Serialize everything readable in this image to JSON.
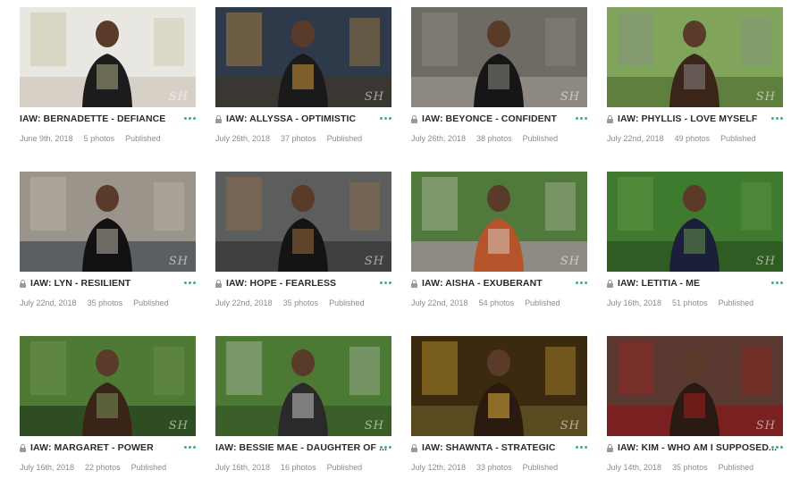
{
  "galleries": [
    {
      "title": "IAW: BERNADETTE - DEFIANCE",
      "date": "June 9th, 2018",
      "photos": "5 photos",
      "status": "Published",
      "locked": false,
      "thumb": {
        "bg": "#e9e7e2",
        "figure": "#1c1c1c",
        "accent": "#b9b98a",
        "ground": "#d6d0c6"
      }
    },
    {
      "title": "IAW: ALLYSSA - OPTIMISTIC",
      "date": "July 26th, 2018",
      "photos": "37 photos",
      "status": "Published",
      "locked": true,
      "thumb": {
        "bg": "#2e3a4a",
        "figure": "#1a1a1a",
        "accent": "#e2a13c",
        "ground": "#3a3632"
      }
    },
    {
      "title": "IAW: BEYONCE - CONFIDENT",
      "date": "July 26th, 2018",
      "photos": "38 photos",
      "status": "Published",
      "locked": true,
      "thumb": {
        "bg": "#6e6a64",
        "figure": "#161616",
        "accent": "#9a968f",
        "ground": "#8d8881"
      }
    },
    {
      "title": "IAW: PHYLLIS - LOVE MYSELF",
      "date": "July 22nd, 2018",
      "photos": "49 photos",
      "status": "Published",
      "locked": true,
      "thumb": {
        "bg": "#7fa45a",
        "figure": "#3b2418",
        "accent": "#8e8e92",
        "ground": "#5f7f3f"
      }
    },
    {
      "title": "IAW: LYN - RESILIENT",
      "date": "July 22nd, 2018",
      "photos": "35 photos",
      "status": "Published",
      "locked": true,
      "thumb": {
        "bg": "#9a948a",
        "figure": "#111111",
        "accent": "#c9c2b5",
        "ground": "#5c5f62"
      }
    },
    {
      "title": "IAW: HOPE - FEARLESS",
      "date": "July 22nd, 2018",
      "photos": "35 photos",
      "status": "Published",
      "locked": true,
      "thumb": {
        "bg": "#5b5e5c",
        "figure": "#141414",
        "accent": "#a6743f",
        "ground": "#3f4140"
      }
    },
    {
      "title": "IAW: AISHA - EXUBERANT",
      "date": "July 22nd, 2018",
      "photos": "54 photos",
      "status": "Published",
      "locked": true,
      "thumb": {
        "bg": "#4f7a3c",
        "figure": "#b5532a",
        "accent": "#d8d2c8",
        "ground": "#8e8a84"
      }
    },
    {
      "title": "IAW: LETITIA - ME",
      "date": "July 16th, 2018",
      "photos": "51 photos",
      "status": "Published",
      "locked": true,
      "thumb": {
        "bg": "#3f7b2f",
        "figure": "#1b1f3a",
        "accent": "#6ca048",
        "ground": "#2f5c22"
      }
    },
    {
      "title": "IAW: MARGARET - POWER",
      "date": "July 16th, 2018",
      "photos": "22 photos",
      "status": "Published",
      "locked": true,
      "thumb": {
        "bg": "#4f7a36",
        "figure": "#3a2418",
        "accent": "#7c9c5a",
        "ground": "#2f4d22"
      }
    },
    {
      "title": "IAW: BESSIE MAE - DAUGHTER OF ...",
      "date": "July 16th, 2018",
      "photos": "16 photos",
      "status": "Published",
      "locked": false,
      "thumb": {
        "bg": "#4c7a34",
        "figure": "#2a2a2a",
        "accent": "#cfcfcf",
        "ground": "#3b5f28"
      }
    },
    {
      "title": "IAW: SHAWNTA - STRATEGIC",
      "date": "July 12th, 2018",
      "photos": "33 photos",
      "status": "Published",
      "locked": true,
      "thumb": {
        "bg": "#3b2a10",
        "figure": "#2a1a10",
        "accent": "#f0c040",
        "ground": "#5a4a20"
      }
    },
    {
      "title": "IAW: KIM - WHO AM I SUPPOSED...",
      "date": "July 14th, 2018",
      "photos": "35 photos",
      "status": "Published",
      "locked": true,
      "thumb": {
        "bg": "#5a3a30",
        "figure": "#2a1a14",
        "accent": "#b01c1c",
        "ground": "#7a2020"
      }
    }
  ],
  "watermark": "SH",
  "accent_color": "#2fb293",
  "icons": {
    "lock": "lock-icon",
    "more": "more-dots-icon"
  }
}
